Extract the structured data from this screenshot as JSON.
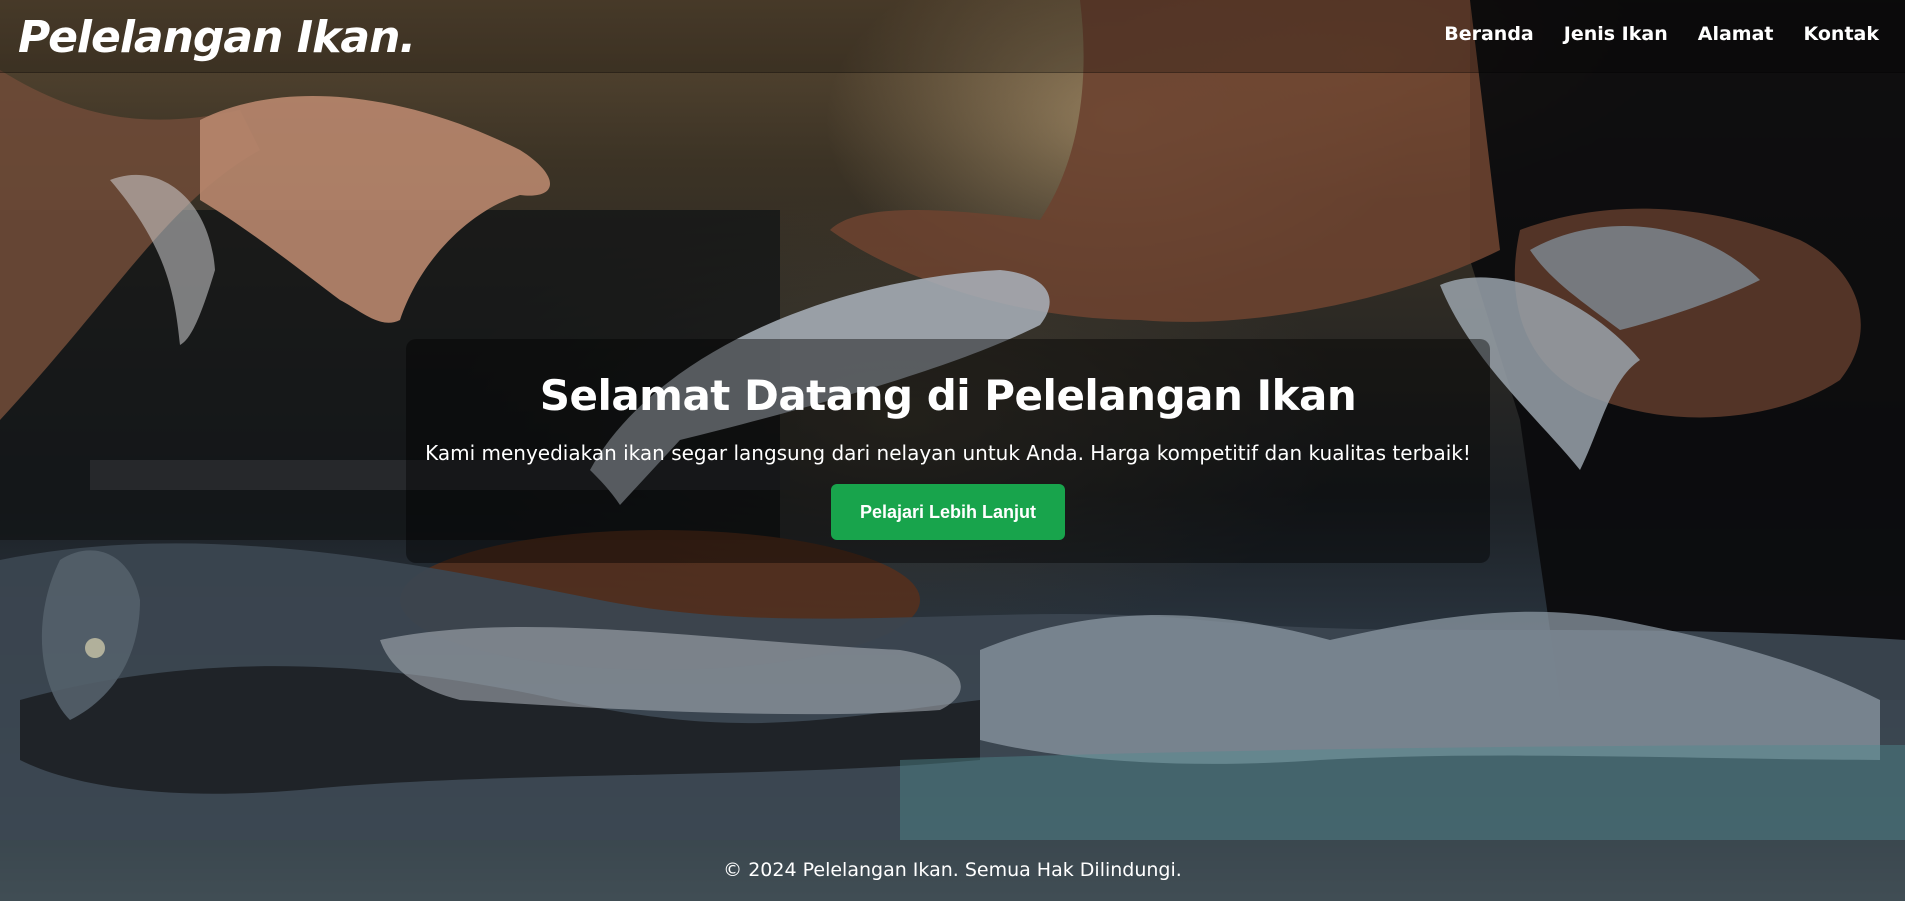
{
  "navbar": {
    "brand": "Pelelangan Ikan.",
    "links": [
      "Beranda",
      "Jenis Ikan",
      "Alamat",
      "Kontak"
    ]
  },
  "hero": {
    "title": "Selamat Datang di Pelelangan Ikan",
    "text": "Kami menyediakan ikan segar langsung dari nelayan untuk Anda. Harga kompetitif dan kualitas terbaik!",
    "button_label": "Pelajari Lebih Lanjut"
  },
  "footer": {
    "text": "© 2024 Pelelangan Ikan. Semua Hak Dilindungi."
  },
  "colors": {
    "accent_button": "#18a44c",
    "text": "#ffffff"
  },
  "icons": {
    "background": "fish-market-photo"
  }
}
